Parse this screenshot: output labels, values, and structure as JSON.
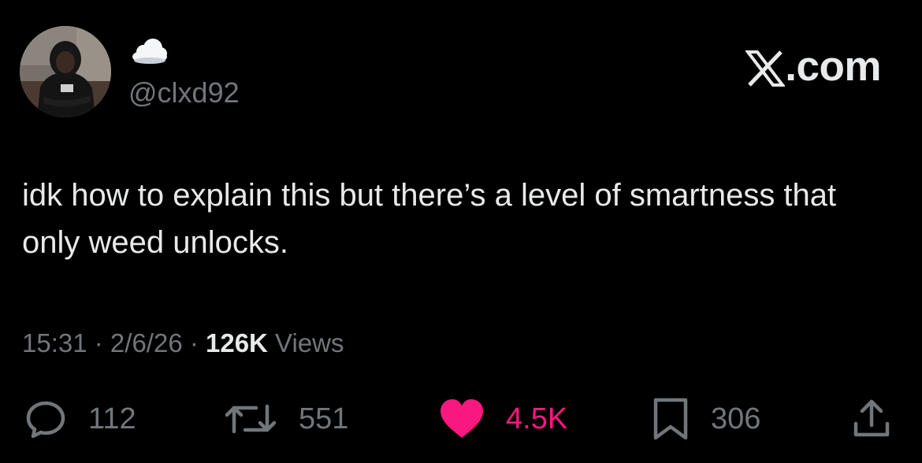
{
  "user": {
    "display_name_emoji": "☁️",
    "handle": "@clxd92",
    "avatar_icon": "user-avatar-photo"
  },
  "brand": {
    "label": ".com",
    "logo_icon": "x-logo-icon"
  },
  "tweet": {
    "text": "idk how to explain this but there’s a level of smartness that only weed unlocks."
  },
  "meta": {
    "time": "15:31",
    "sep1": " · ",
    "date": "2/6/26",
    "sep2": " · ",
    "views_count": "126K",
    "views_label": " Views"
  },
  "actions": {
    "replies": "112",
    "reposts": "551",
    "likes": "4.5K",
    "bookmarks": "306"
  },
  "colors": {
    "background": "#000000",
    "text": "#e7e9ea",
    "muted": "#71767b",
    "like": "#f91880"
  }
}
